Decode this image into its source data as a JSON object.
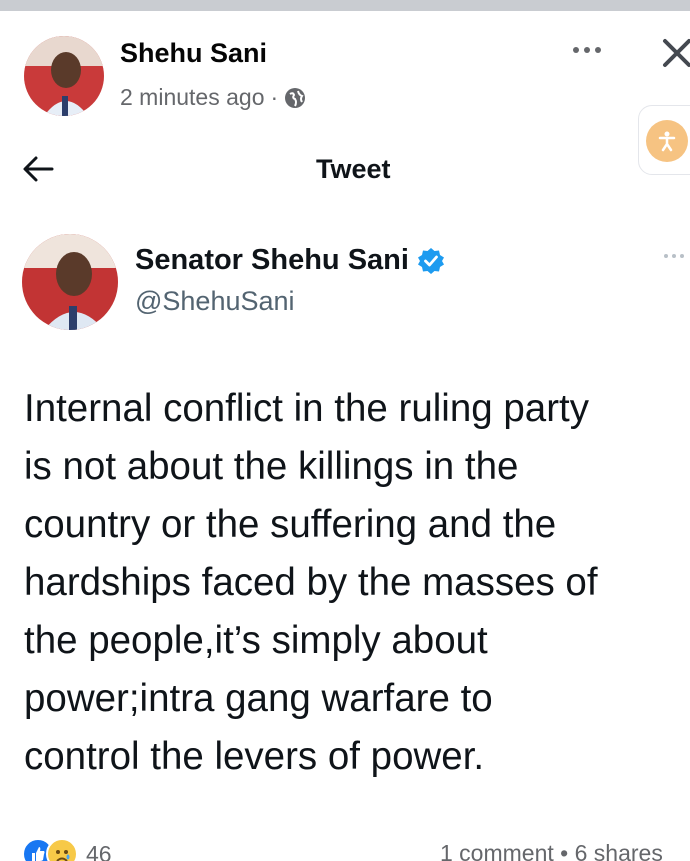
{
  "post": {
    "author": "Shehu Sani",
    "time": "2 minutes ago",
    "separator": "·"
  },
  "tweet": {
    "heading": "Tweet",
    "name": "Senator Shehu Sani",
    "handle": "@ShehuSani",
    "text": "Internal conflict in the ruling party\nis not about the killings in the\ncountry or the suffering and the\nhardships faced by the masses of\nthe people,it’s simply about\npower;intra gang warfare to\ncontrol the levers of power."
  },
  "footer": {
    "reaction_count": "46",
    "engagement": "1 comment • 6 shares"
  },
  "colors": {
    "verified": "#1d9bf0",
    "like": "#1877f2",
    "accessibility": "#f6c382"
  },
  "icons": [
    "globe-icon",
    "more-icon",
    "close-icon",
    "accessibility-icon",
    "back-arrow-icon",
    "verified-icon",
    "like-icon",
    "sad-icon"
  ]
}
